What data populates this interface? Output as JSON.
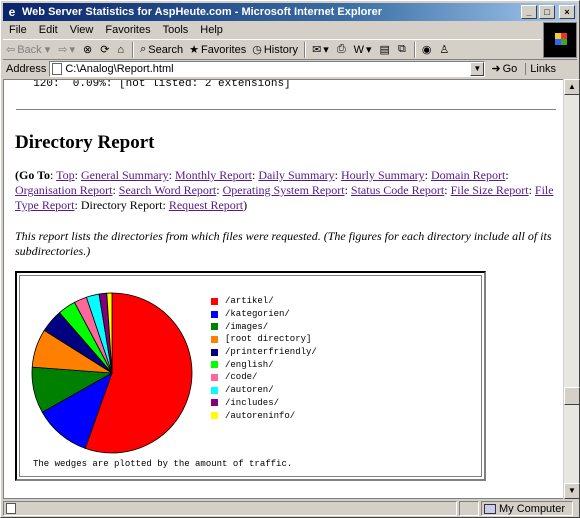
{
  "window": {
    "title": "Web Server Statistics for AspHeute.com - Microsoft Internet Explorer",
    "minimize": "_",
    "maximize": "□",
    "close": "×"
  },
  "menu": [
    "File",
    "Edit",
    "View",
    "Favorites",
    "Tools",
    "Help"
  ],
  "toolbar": {
    "back": "Back",
    "forward": "",
    "search": "Search",
    "favorites": "Favorites",
    "history": "History"
  },
  "address": {
    "label": "Address",
    "value": "C:\\Analog\\Report.html",
    "go": "Go",
    "links": "Links"
  },
  "page": {
    "pre_line": "  120:  0.09%: [not listed: 2 extensions]",
    "heading": "Directory Report",
    "goto_label": "(Go To",
    "goto_links": [
      "Top",
      "General Summary",
      "Monthly Report",
      "Daily Summary",
      "Hourly Summary",
      "Domain Report",
      "Organisation Report",
      "Search Word Report",
      "Operating System Report",
      "Status Code Report",
      "File Size Report",
      "File Type Report"
    ],
    "goto_tail_text": "Directory Report",
    "goto_last_link": "Request Report",
    "intro": "This report lists the directories from which files were requested. (The figures for each directory include all of its subdirectories.)",
    "caption": "The wedges are plotted by the amount of traffic."
  },
  "chart_data": {
    "type": "pie",
    "title": "",
    "categories": [
      "/artikel/",
      "/kategorien/",
      "/images/",
      "[root directory]",
      "/printerfriendly/",
      "/english/",
      "/code/",
      "/autoren/",
      "/includes/",
      "/autoreninfo/"
    ],
    "values": [
      53.5,
      11.0,
      9.0,
      7.5,
      4.5,
      3.5,
      2.5,
      2.5,
      1.5,
      1.0
    ],
    "colors": [
      "#ff0000",
      "#0000ff",
      "#008000",
      "#ff8000",
      "#000080",
      "#00ff00",
      "#ff6699",
      "#00ffff",
      "#800080",
      "#ffff00"
    ],
    "legend": "right"
  },
  "status": {
    "zone": "My Computer"
  }
}
